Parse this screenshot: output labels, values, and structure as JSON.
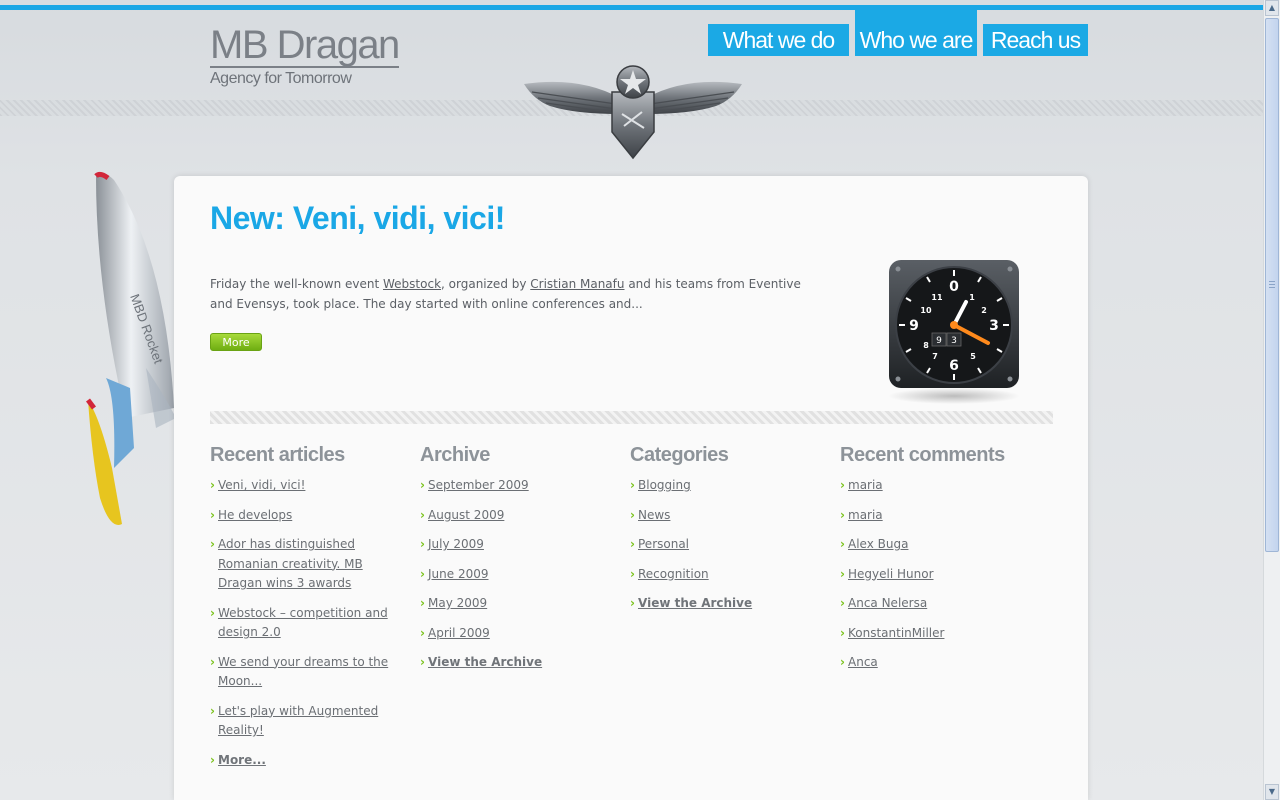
{
  "header": {
    "logo_title": "MB Dragan",
    "logo_tagline": "Agency for Tomorrow",
    "nav": [
      {
        "label": "What we do"
      },
      {
        "label": "Who we are"
      },
      {
        "label": "Reach us"
      }
    ]
  },
  "rocket_label": "MBD Rocket",
  "post": {
    "title": "New: Veni, vidi, vici!",
    "excerpt_part1": "Friday the well-known event ",
    "excerpt_link1": "Webstock",
    "excerpt_part2": ", organized by ",
    "excerpt_link2": "Cristian Manafu",
    "excerpt_part3": " and his teams from Eventive and Evensys, took place. The day started with online conferences and...",
    "more_label": "More",
    "clock_numerals": [
      "0",
      "1",
      "2",
      "3",
      "5",
      "6",
      "7",
      "8",
      "9",
      "10",
      "11"
    ],
    "clock_counter": [
      "9",
      "3"
    ]
  },
  "columns": {
    "recent_articles": {
      "heading": "Recent articles",
      "items": [
        {
          "label": "Veni, vidi, vici!"
        },
        {
          "label": "He develops"
        },
        {
          "label": "Ador has distinguished Romanian creativity. MB Dragan wins 3 awards"
        },
        {
          "label": "Webstock – competition and design 2.0"
        },
        {
          "label": "We send your dreams to the Moon..."
        },
        {
          "label": "Let's play with Augmented Reality!"
        },
        {
          "label": "More..."
        }
      ]
    },
    "archive": {
      "heading": "Archive",
      "items": [
        {
          "label": "September 2009"
        },
        {
          "label": "August 2009"
        },
        {
          "label": "July 2009"
        },
        {
          "label": "June 2009"
        },
        {
          "label": "May 2009"
        },
        {
          "label": "April 2009"
        },
        {
          "label": "View the Archive"
        }
      ]
    },
    "categories": {
      "heading": "Categories",
      "items": [
        {
          "label": "Blogging"
        },
        {
          "label": "News"
        },
        {
          "label": "Personal"
        },
        {
          "label": "Recognition"
        },
        {
          "label": "View the Archive"
        }
      ]
    },
    "recent_comments": {
      "heading": "Recent comments",
      "items": [
        {
          "label": "maria"
        },
        {
          "label": "maria"
        },
        {
          "label": "Alex Buga"
        },
        {
          "label": "Hegyeli Hunor"
        },
        {
          "label": "Anca Nelersa"
        },
        {
          "label": "KonstantinMiller"
        },
        {
          "label": "Anca"
        }
      ]
    }
  },
  "colors": {
    "accent_blue": "#1aa7e6",
    "button_green": "#7cc31e",
    "text_gray": "#6b6f74"
  }
}
